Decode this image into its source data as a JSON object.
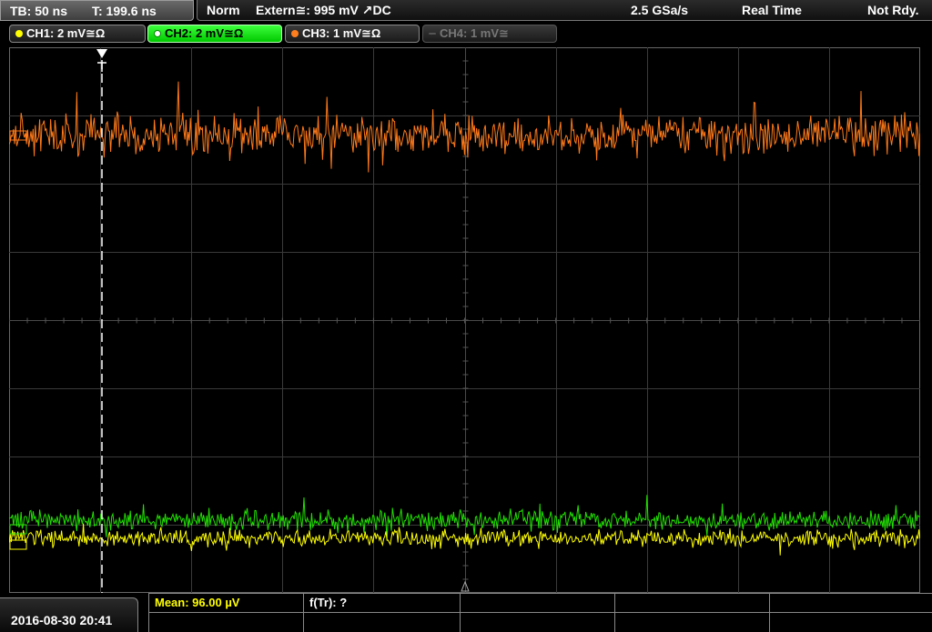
{
  "status_bar": {
    "timebase": "TB: 50 ns",
    "trigger_time": "T: 199.6 ns",
    "trigger_mode": "Norm",
    "trigger_source": "Extern≅: 995 mV ↗DC",
    "sample_rate": "2.5 GSa/s",
    "acq_mode": "Real Time",
    "state": "Not Rdy."
  },
  "channels": [
    {
      "label": "CH1: 2 mV≅Ω",
      "color": "#ffff00",
      "active": false,
      "enabled": true
    },
    {
      "label": "CH2: 2 mV≅Ω",
      "color": "#00ff00",
      "active": true,
      "enabled": true
    },
    {
      "label": "CH3: 1 mV≅Ω",
      "color": "#ff7f1f",
      "active": false,
      "enabled": true
    },
    {
      "label": "CH4: 1 mV≅",
      "color": "#777777",
      "active": false,
      "enabled": false
    }
  ],
  "waveform_colors": {
    "ch1": "#ffff00",
    "ch2": "#22e000",
    "ch3": "#ff7a1a"
  },
  "bottom": {
    "datetime": "2016-08-30 20:41",
    "mean_label": "Mean: 96.00 µV",
    "ftr_label": "f(Tr): ?",
    "mean_color": "#ffff00"
  }
}
